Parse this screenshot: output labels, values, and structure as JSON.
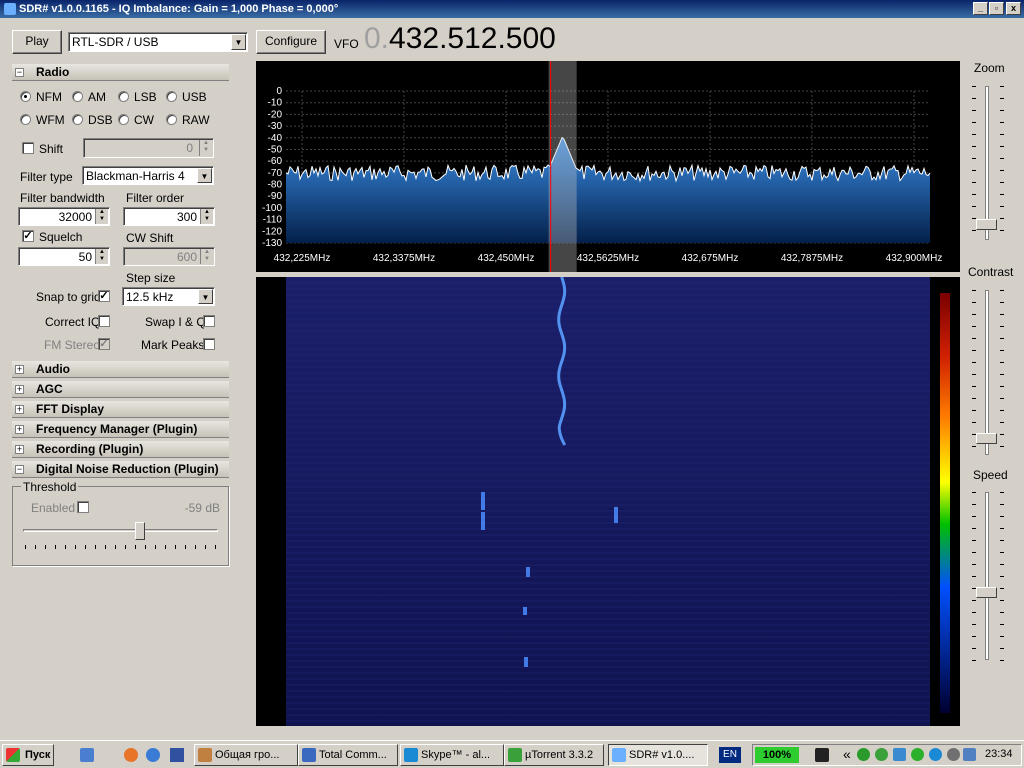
{
  "window": {
    "title": "SDR# v1.0.0.1165 - IQ Imbalance: Gain = 1,000 Phase = 0,000°",
    "min": "_",
    "max": "▫",
    "close": "x"
  },
  "toolbar": {
    "play": "Play",
    "device": "RTL-SDR / USB",
    "configure": "Configure",
    "vfo_label": "VFO",
    "vfo_prefix": "0.",
    "vfo_value": "432.512.500"
  },
  "radio": {
    "title": "Radio",
    "modes": [
      "NFM",
      "AM",
      "LSB",
      "USB",
      "WFM",
      "DSB",
      "CW",
      "RAW"
    ],
    "selected_mode": "NFM",
    "shift_label": "Shift",
    "shift_value": "0",
    "filter_type_label": "Filter type",
    "filter_type": "Blackman-Harris 4",
    "filter_bw_label": "Filter bandwidth",
    "filter_bw": "32000",
    "filter_order_label": "Filter order",
    "filter_order": "300",
    "squelch_label": "Squelch",
    "squelch": "50",
    "cw_shift_label": "CW Shift",
    "cw_shift": "600",
    "step_size_label": "Step size",
    "step_size": "12.5 kHz",
    "snap_label": "Snap to grid",
    "swap_label": "Swap I & Q",
    "correct_iq_label": "Correct IQ",
    "fm_stereo_label": "FM Stereo",
    "mark_peaks_label": "Mark Peaks",
    "checks": {
      "squelch": true,
      "snap": true,
      "correct_iq": false,
      "swap": false,
      "fm_stereo": true,
      "mark_peaks": false,
      "shift": false
    }
  },
  "sections": [
    {
      "title": "Audio",
      "expanded": false
    },
    {
      "title": "AGC",
      "expanded": false
    },
    {
      "title": "FFT Display",
      "expanded": false
    },
    {
      "title": "Frequency Manager (Plugin)",
      "expanded": false
    },
    {
      "title": "Recording (Plugin)",
      "expanded": false
    },
    {
      "title": "Digital Noise Reduction (Plugin)",
      "expanded": true
    }
  ],
  "dnr": {
    "group": "Threshold",
    "enabled_label": "Enabled",
    "enabled": false,
    "value": "-59 dB",
    "slider_level": 0.6
  },
  "spectrum": {
    "db_labels": [
      "0",
      "-10",
      "-20",
      "-30",
      "-40",
      "-50",
      "-60",
      "-70",
      "-80",
      "-90",
      "-100",
      "-110",
      "-120",
      "-130"
    ],
    "freq_labels": [
      "432,225MHz",
      "432,3375MHz",
      "432,450MHz",
      "432,5625MHz",
      "432,675MHz",
      "432,7875MHz",
      "432,900MHz"
    ],
    "peak_freq_mhz": 432.5125
  },
  "right": {
    "zoom": "Zoom",
    "contrast": "Contrast",
    "speed": "Speed",
    "zoom_level": 0.1,
    "contrast_level": 0.1,
    "speed_level": 0.4
  },
  "taskbar": {
    "start": "Пуск",
    "tasks": [
      "Общая гро...",
      "Total Comm...",
      "Skype™ - al...",
      "µTorrent 3.3.2",
      "SDR# v1.0...."
    ],
    "lang": "EN",
    "battery": "100%",
    "tray_chevron": "«",
    "clock": "23:34"
  },
  "colors": {
    "accent_title": "#0a246a",
    "spectrum_fill": "#1a5fb4",
    "vfo_line": "#ff0000"
  }
}
